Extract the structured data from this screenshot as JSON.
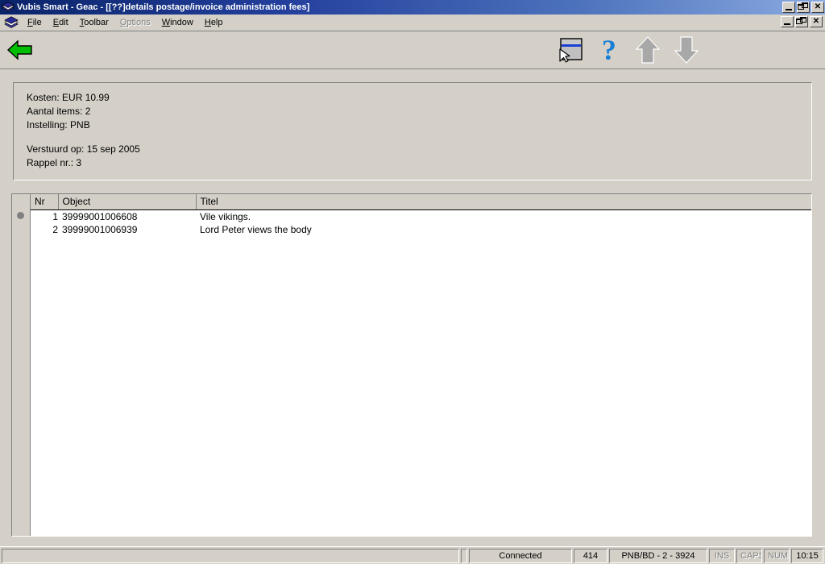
{
  "window": {
    "title": "Vubis Smart - Geac - [[??]details postage/invoice administration fees]",
    "app_icon": "books-icon",
    "controls": {
      "minimize": "_",
      "restore": "restore",
      "close": "✕"
    }
  },
  "menubar": {
    "items": [
      {
        "label": "File",
        "mnemonic": "F",
        "disabled": false
      },
      {
        "label": "Edit",
        "mnemonic": "E",
        "disabled": false
      },
      {
        "label": "Toolbar",
        "mnemonic": "T",
        "disabled": false
      },
      {
        "label": "Options",
        "mnemonic": "O",
        "disabled": true
      },
      {
        "label": "Window",
        "mnemonic": "W",
        "disabled": false
      },
      {
        "label": "Help",
        "mnemonic": "H",
        "disabled": false
      }
    ]
  },
  "toolbar": {
    "back": {
      "name": "back-arrow-icon",
      "tooltip": "Back"
    },
    "buttons": [
      {
        "name": "select-record-icon",
        "tooltip": "Select record"
      },
      {
        "name": "help-question-icon",
        "tooltip": "Help",
        "glyph": "?"
      },
      {
        "name": "arrow-up-icon",
        "tooltip": "Previous"
      },
      {
        "name": "arrow-down-icon",
        "tooltip": "Next"
      }
    ]
  },
  "info_panel": {
    "lines": [
      "Kosten: EUR 10.99",
      "Aantal items: 2",
      "Instelling: PNB",
      "",
      "Verstuurd op: 15 sep 2005",
      "Rappel nr.: 3"
    ],
    "fields": {
      "kosten_label": "Kosten:",
      "kosten_value": "EUR 10.99",
      "aantal_items_label": "Aantal items:",
      "aantal_items_value": "2",
      "instelling_label": "Instelling:",
      "instelling_value": "PNB",
      "verstuurd_op_label": "Verstuurd op:",
      "verstuurd_op_value": "15 sep 2005",
      "rappel_nr_label": "Rappel nr.:",
      "rappel_nr_value": "3"
    }
  },
  "list": {
    "columns": [
      "Nr",
      "Object",
      "Titel"
    ],
    "selected_row": 0,
    "rows": [
      {
        "nr": "1",
        "object": "39999001006608",
        "titel": "Vile vikings."
      },
      {
        "nr": "2",
        "object": "39999001006939",
        "titel": "Lord Peter views the body"
      }
    ]
  },
  "statusbar": {
    "message": "",
    "connection": "Connected",
    "counter": "414",
    "location": "PNB/BD - 2 - 3924",
    "ins": "INS",
    "caps": "CAPS",
    "num": "NUM",
    "time": "10:15"
  },
  "colors": {
    "face": "#d4d0c8",
    "title_dark": "#0a246a",
    "title_light": "#8aaae0",
    "accent_green": "#00a000",
    "accent_blue": "#1a7fd4",
    "arrow_gray": "#a0a0a0"
  }
}
